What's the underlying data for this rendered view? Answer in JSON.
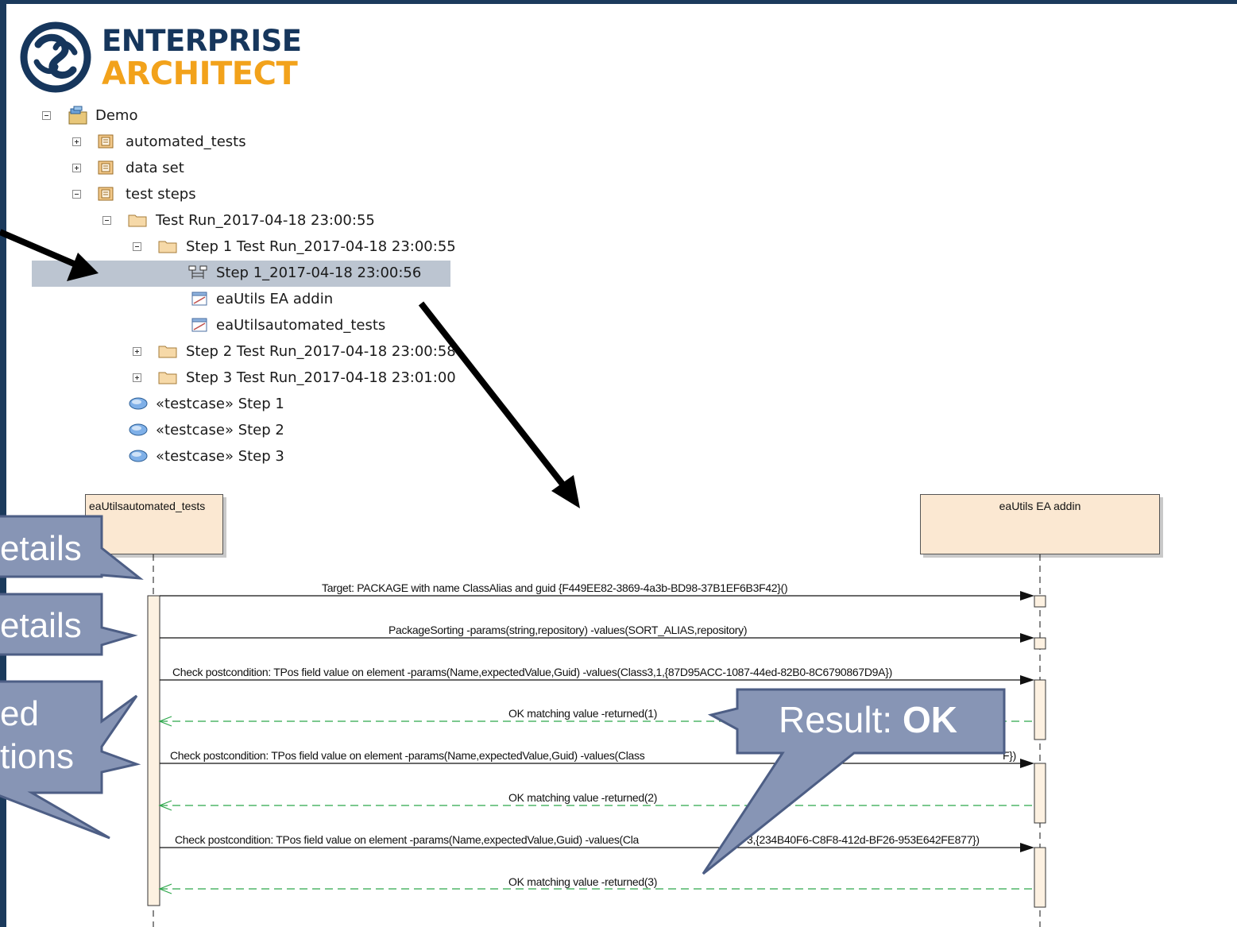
{
  "logo": {
    "line1": "ENTERPRISE",
    "line2": "ARCHITECT"
  },
  "tree": {
    "root": "Demo",
    "items": [
      {
        "label": "automated_tests"
      },
      {
        "label": "data set"
      },
      {
        "label": "test steps"
      },
      {
        "label": "Test Run_2017-04-18 23:00:55"
      },
      {
        "label": "Step 1 Test Run_2017-04-18 23:00:55"
      },
      {
        "label": "Step 1_2017-04-18 23:00:56"
      },
      {
        "label": "eaUtils EA addin"
      },
      {
        "label": "eaUtilsautomated_tests"
      },
      {
        "label": "Step 2 Test Run_2017-04-18 23:00:58"
      },
      {
        "label": "Step 3 Test Run_2017-04-18 23:01:00"
      },
      {
        "label": "«testcase» Step 1"
      },
      {
        "label": "«testcase» Step 2"
      },
      {
        "label": "«testcase» Step 3"
      }
    ]
  },
  "diagram": {
    "lifelines": [
      {
        "name": "eaUtilsautomated_tests"
      },
      {
        "name": "eaUtils EA addin"
      }
    ],
    "messages": [
      {
        "text": "Target: PACKAGE with name ClassAlias and guid {F449EE82-3869-4a3b-BD98-37B1EF6B3F42}()"
      },
      {
        "text": "PackageSorting -params(string,repository) -values(SORT_ALIAS,repository)"
      },
      {
        "text": "Check postcondition: TPos field value on element -params(Name,expectedValue,Guid) -values(Class3,1,{87D95ACC-1087-44ed-82B0-8C6790867D9A})"
      },
      {
        "text": "OK matching value -returned(1)"
      },
      {
        "text": "Check postcondition: TPos field value on element -params(Name,expectedValue,Guid) -values(Class"
      },
      {
        "text": "F})"
      },
      {
        "text": "OK matching value -returned(2)"
      },
      {
        "text": "Check postcondition: TPos field value on element -params(Name,expectedValue,Guid) -values(Cla"
      },
      {
        "text": "3,{234B40F6-C8F8-412d-BF26-953E642FE877})"
      },
      {
        "text": "OK matching value -returned(3)"
      }
    ]
  },
  "callouts": {
    "details1": "etails",
    "details2": "etails",
    "conditions_l1": "ed",
    "conditions_l2": "tions",
    "result_prefix": "Result: ",
    "result_value": "OK"
  },
  "colors": {
    "frame": "#1b3a5c",
    "logo_blue": "#16365c",
    "logo_orange": "#f2a21b",
    "callout_fill": "#8795b5",
    "callout_border": "#4d5e85",
    "lifeline_fill": "#fbe8d2",
    "return_line": "#2ca64a",
    "selection": "#bcc5d1"
  }
}
